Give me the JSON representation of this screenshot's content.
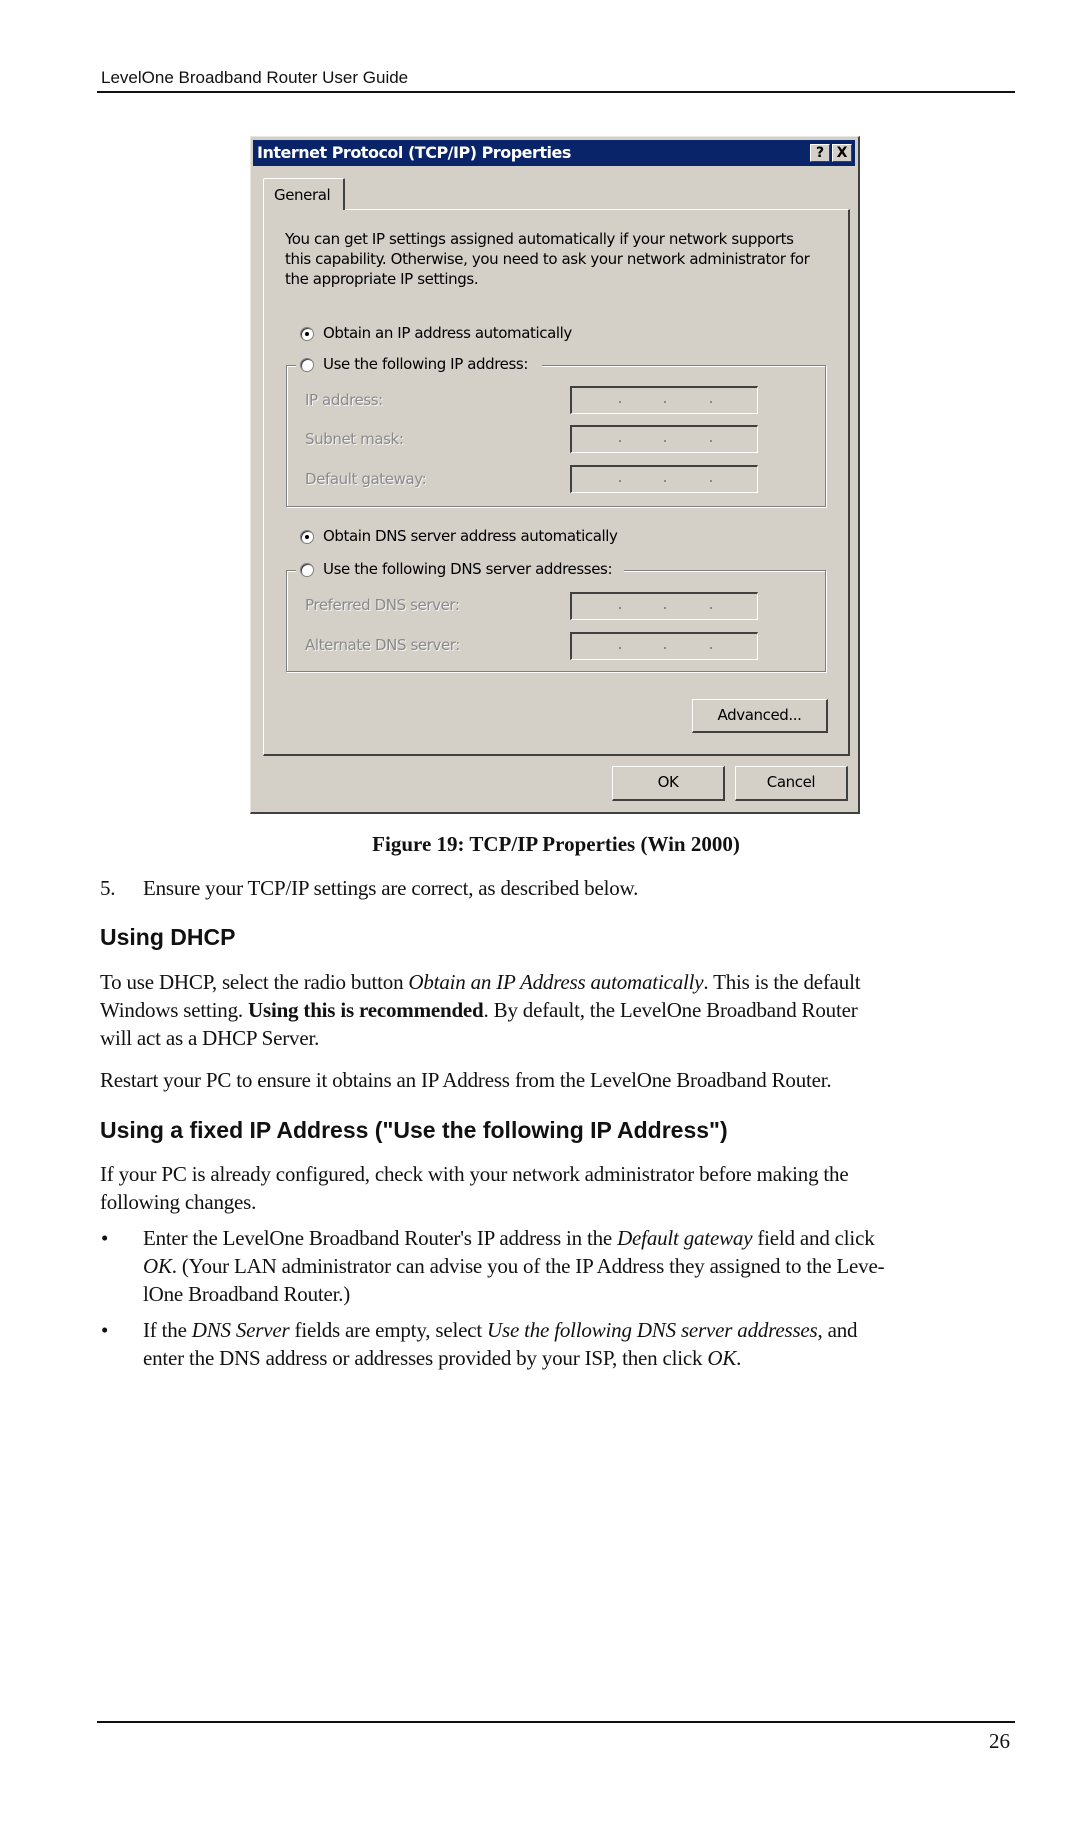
{
  "header": {
    "title": "LevelOne Broadband Router User Guide"
  },
  "dialog": {
    "title": "Internet Protocol (TCP/IP) Properties",
    "help_button": "?",
    "close_button": "X",
    "tab": "General",
    "description": [
      "You can get IP settings assigned automatically if your network supports",
      "this capability. Otherwise, you need to ask your network administrator for",
      "the appropriate IP settings."
    ],
    "ip_mode": {
      "auto_label": "Obtain an IP address automatically",
      "manual_label": "Use the following IP address:",
      "selected": "auto"
    },
    "ip_fields": [
      {
        "label": "IP address:",
        "value": " .  .  . "
      },
      {
        "label": "Subnet mask:",
        "value": " .  .  . "
      },
      {
        "label": "Default gateway:",
        "value": " .  .  . "
      }
    ],
    "dns_mode": {
      "auto_label": "Obtain DNS server address automatically",
      "manual_label": "Use the following DNS server addresses:",
      "selected": "auto"
    },
    "dns_fields": [
      {
        "label": "Preferred DNS server:",
        "value": " .  .  . "
      },
      {
        "label": "Alternate DNS server:",
        "value": " .  .  . "
      }
    ],
    "advanced_button": "Advanced...",
    "ok_button": "OK",
    "cancel_button": "Cancel",
    "colors": {
      "titlebar": "#0a246a",
      "face": "#d4d0c8"
    }
  },
  "caption": "Figure 19: TCP/IP Properties (Win 2000)",
  "step5": {
    "number": "5.",
    "text": "Ensure your TCP/IP settings are correct, as described below."
  },
  "section_dhcp": {
    "heading": "Using DHCP",
    "para1": {
      "t1": "To use DHCP, select the radio button ",
      "i1": "Obtain an IP Address automatically",
      "t2": ". This is the default",
      "line2_t1": "Windows setting. ",
      "b1": "Using this is recommended",
      "line2_t2": ". By default, the LevelOne Broadband Router",
      "line3": "will act as a DHCP Server."
    },
    "para2": "Restart your PC to ensure it obtains an IP Address from the LevelOne Broadband Router."
  },
  "section_fixed": {
    "heading": "Using a fixed IP Address (\"Use the following IP Address\")",
    "para_line1": "If your PC is already configured, check with your network administrator before making the",
    "para_line2": "following changes.",
    "bullet_glyph": "•",
    "bullet1": {
      "t1": "Enter the LevelOne Broadband Router's IP address in the ",
      "i1": "Default gateway",
      "t2": " field and click",
      "line2_i": "OK",
      "line2_t": ". (Your LAN administrator can advise you of the IP Address they assigned to the Leve-",
      "line3": "lOne Broadband Router.)"
    },
    "bullet2": {
      "t1": "If the ",
      "i1": "DNS Server",
      "t2": " fields are empty, select ",
      "i2": "Use the following DNS server addresses",
      "t3": ", and",
      "line2_t": "enter the DNS address or addresses provided by your ISP, then click ",
      "line2_i": "OK",
      "line2_end": "."
    }
  },
  "footer": {
    "page_number": "26"
  }
}
